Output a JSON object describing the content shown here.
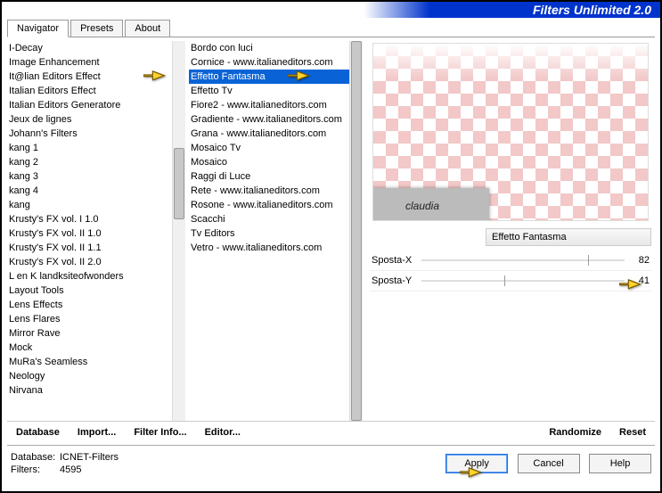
{
  "header": {
    "title": "Filters Unlimited 2.0"
  },
  "tabs": {
    "items": [
      "Navigator",
      "Presets",
      "About"
    ],
    "active": 0
  },
  "left_list": {
    "items": [
      "I-Decay",
      "Image Enhancement",
      "It@lian Editors Effect",
      "Italian Editors Effect",
      "Italian Editors Generatore",
      "Jeux de lignes",
      "Johann's Filters",
      "kang 1",
      "kang 2",
      "kang 3",
      "kang 4",
      "kang",
      "Krusty's FX vol. I 1.0",
      "Krusty's FX vol. II 1.0",
      "Krusty's FX vol. II 1.1",
      "Krusty's FX vol. II 2.0",
      "L en K landksiteofwonders",
      "Layout Tools",
      "Lens Effects",
      "Lens Flares",
      "Mirror Rave",
      "Mock",
      "MuRa's Seamless",
      "Neology",
      "Nirvana"
    ],
    "selected": 2
  },
  "mid_list": {
    "items": [
      "Bordo con luci",
      "Cornice - www.italianeditors.com",
      "Effetto Fantasma",
      "Effetto Tv",
      "Fiore2 - www.italianeditors.com",
      "Gradiente - www.italianeditors.com",
      "Grana - www.italianeditors.com",
      "Mosaico Tv",
      "Mosaico",
      "Raggi di Luce",
      "Rete - www.italianeditors.com",
      "Rosone - www.italianeditors.com",
      "Scacchi",
      "Tv Editors",
      "Vetro - www.italianeditors.com"
    ],
    "selected": 2
  },
  "effect": {
    "name": "Effetto Fantasma",
    "params": [
      {
        "label": "Sposta-X",
        "value": 82,
        "max": 100
      },
      {
        "label": "Sposta-Y",
        "value": 41,
        "max": 100
      }
    ]
  },
  "preview_strip": "claudia",
  "buttons": {
    "database": "Database",
    "import": "Import...",
    "filter_info": "Filter Info...",
    "editor": "Editor...",
    "randomize": "Randomize",
    "reset": "Reset",
    "apply": "Apply",
    "cancel": "Cancel",
    "help": "Help"
  },
  "status": {
    "db_label": "Database:",
    "db_value": "ICNET-Filters",
    "fl_label": "Filters:",
    "fl_value": "4595"
  }
}
